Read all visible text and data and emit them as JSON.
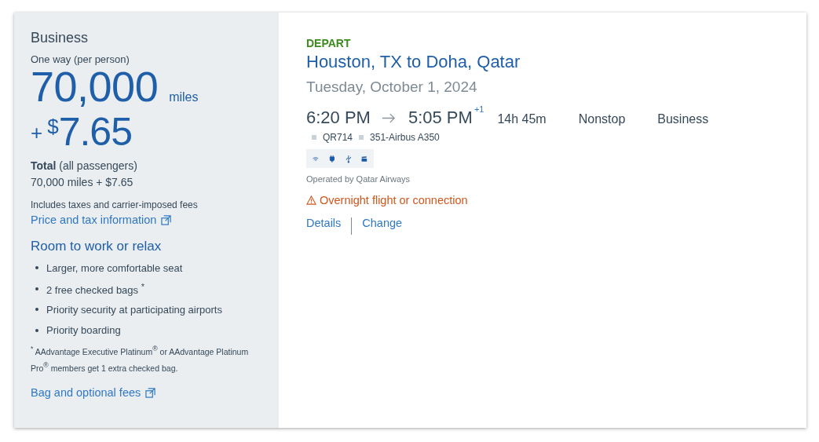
{
  "fare": {
    "cabin": "Business",
    "trip_note": "One way (per person)",
    "miles": "70,000",
    "miles_unit": "miles",
    "plus": "+",
    "currency": "$",
    "amount": "7.65",
    "total_label": "**Total** (all passengers)",
    "total_value": "70,000 miles + $7.65",
    "taxes_note": "Includes taxes and carrier-imposed fees",
    "price_link": "Price and tax information"
  },
  "benefits": {
    "heading": "Room to work or relax",
    "items": [
      "Larger, more comfortable seat",
      "2 free checked bags $^{*}$",
      "Priority security at participating airports",
      "Priority boarding"
    ],
    "footnote": "$^{*}$ AAdvantage Executive Platinum$^{®}$ or AAdvantage Platinum Pro$^{®}$ members get 1 extra checked bag.",
    "fees_link": "Bag and optional fees"
  },
  "flight": {
    "direction": "DEPART",
    "route": "Houston, TX to Doha, Qatar",
    "date": "Tuesday, October 1, 2024",
    "depart_time": "6:20 PM",
    "arrive_time": "5:05 PM",
    "day_offset": "+1",
    "duration": "14h 45m",
    "stops": "Nonstop",
    "cabin": "Business",
    "flight_number": "QR714",
    "aircraft": "351-Airbus A350",
    "operated_by": "Operated by Qatar Airways",
    "warning": "Overnight flight or connection",
    "links": [
      "Details",
      "Change"
    ]
  }
}
